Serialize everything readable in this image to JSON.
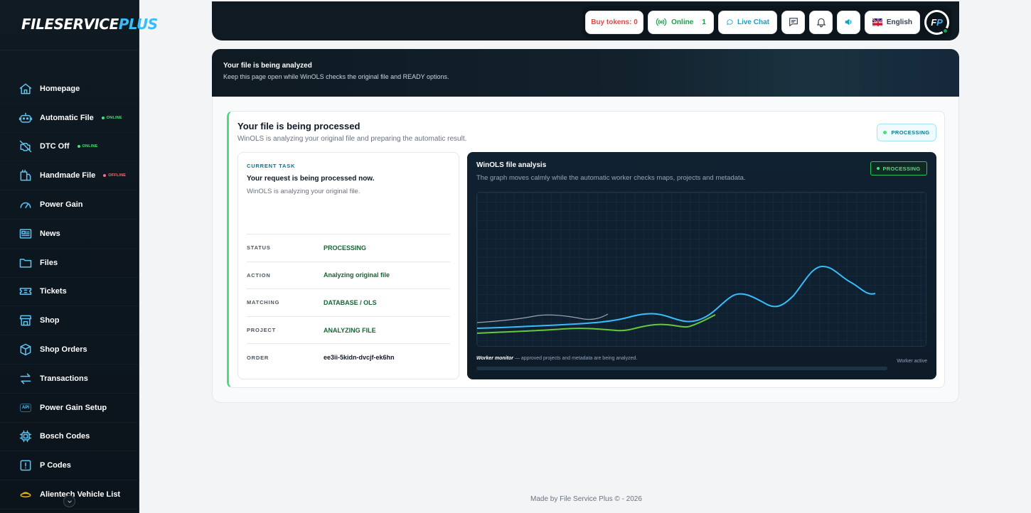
{
  "brand": {
    "part1": "FILESERVICE",
    "part2": "PLUS"
  },
  "sidebar": {
    "items": [
      {
        "label": "Homepage",
        "icon": "home-icon"
      },
      {
        "label": "Automatic File",
        "icon": "robot-icon",
        "badge": "ONLINE",
        "badge_status": "online"
      },
      {
        "label": "DTC Off",
        "icon": "engine-off-icon",
        "badge": "ONLINE",
        "badge_status": "online"
      },
      {
        "label": "Handmade File",
        "icon": "tool-icon",
        "badge": "OFFLINE",
        "badge_status": "offline"
      },
      {
        "label": "Power Gain",
        "icon": "speedometer-icon"
      },
      {
        "label": "News",
        "icon": "newspaper-icon"
      },
      {
        "label": "Files",
        "icon": "folder-icon"
      },
      {
        "label": "Tickets",
        "icon": "ticket-icon"
      },
      {
        "label": "Shop",
        "icon": "shop-icon"
      },
      {
        "label": "Shop Orders",
        "icon": "box-icon"
      },
      {
        "label": "Transactions",
        "icon": "transfer-icon"
      },
      {
        "label": "Power Gain Setup",
        "icon": "api-icon",
        "icon_text": "API"
      },
      {
        "label": "Bosch Codes",
        "icon": "chip-icon"
      },
      {
        "label": "P Codes",
        "icon": "alert-icon"
      },
      {
        "label": "Alientech Vehicle List",
        "icon": "alientech-logo-icon"
      }
    ]
  },
  "header": {
    "tokens_label": "Buy tokens: 0",
    "online_label": "Online",
    "online_count": "1",
    "chat_label": "Live Chat",
    "language": "English",
    "avatar_initials_f": "F",
    "avatar_initials_p": "P"
  },
  "banner": {
    "title": "Your file is being analyzed",
    "subtitle": "Keep this page open while WinOLS checks the original file and READY options."
  },
  "card": {
    "title": "Your file is being processed",
    "subtitle": "WinOLS is analyzing your original file and preparing the automatic result.",
    "status_pill": "PROCESSING"
  },
  "task": {
    "kicker": "CURRENT TASK",
    "heading": "Your request is being processed now.",
    "description": "WinOLS is analyzing your original file.",
    "rows": [
      {
        "key": "STATUS",
        "value": "PROCESSING"
      },
      {
        "key": "ACTION",
        "value": "Analyzing original file"
      },
      {
        "key": "MATCHING",
        "value": "DATABASE / OLS"
      },
      {
        "key": "PROJECT",
        "value": "ANALYZING FILE"
      },
      {
        "key": "ORDER",
        "value": "ee3ii-5kidn-dvcjf-ek6hn"
      }
    ]
  },
  "analysis": {
    "title": "WinOLS file analysis",
    "subtitle": "The graph moves calmly while the automatic worker checks maps, projects and metadata.",
    "pill": "PROCESSING",
    "monitor_label": "Worker monitor",
    "monitor_text": " — approved projects and metadata are being analyzed.",
    "worker_status": "Worker active",
    "colors": {
      "blue_line": "#38bdf8",
      "green_line": "#65c93a",
      "gray_line": "#9ca3af"
    }
  },
  "footer": "Made by File Service Plus © - 2026"
}
